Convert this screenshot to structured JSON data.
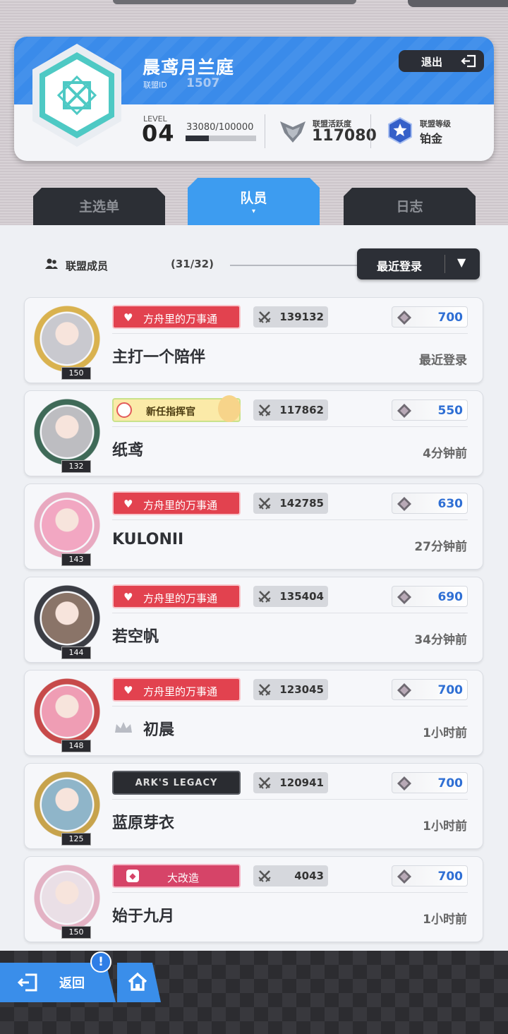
{
  "alliance": {
    "name": "晨鸢月兰庭",
    "id_label": "联盟ID",
    "id": "1507",
    "exit_label": "退出",
    "level_label": "LEVEL",
    "level": "04",
    "exp_text": "33080/100000",
    "exp_progress": 0.33,
    "activity_label": "联盟活跃度",
    "activity_value": "117080",
    "rank_label": "联盟等级",
    "rank_value": "铂金"
  },
  "tabs": [
    {
      "label": "主选单"
    },
    {
      "label": "队员",
      "active": true,
      "marker": "▾"
    },
    {
      "label": "日志"
    }
  ],
  "members_header": {
    "label": "联盟成员",
    "count": "(31/32)",
    "sort_label": "最近登录",
    "sort_caret": "▼"
  },
  "members": [
    {
      "name": "主打一个陪伴",
      "level": "150",
      "badge": "方舟里的万事通",
      "badge_type": "red",
      "power": "139132",
      "donation": "700",
      "last_login": "最近登录",
      "crown": false
    },
    {
      "name": "纸鸢",
      "level": "132",
      "badge": "新任指挥官",
      "badge_type": "newbie",
      "power": "117862",
      "donation": "550",
      "last_login": "4分钟前",
      "crown": false
    },
    {
      "name": "KULONII",
      "level": "143",
      "badge": "方舟里的万事通",
      "badge_type": "red",
      "power": "142785",
      "donation": "630",
      "last_login": "27分钟前",
      "crown": false
    },
    {
      "name": "若空帆",
      "level": "144",
      "badge": "方舟里的万事通",
      "badge_type": "red",
      "power": "135404",
      "donation": "690",
      "last_login": "34分钟前",
      "crown": false
    },
    {
      "name": "初晨",
      "level": "148",
      "badge": "方舟里的万事通",
      "badge_type": "red",
      "power": "123045",
      "donation": "700",
      "last_login": "1小时前",
      "crown": true
    },
    {
      "name": "蓝原芽衣",
      "level": "125",
      "badge": "ARK'S LEGACY",
      "badge_type": "legacy",
      "power": "120941",
      "donation": "700",
      "last_login": "1小时前",
      "crown": false
    },
    {
      "name": "始于九月",
      "level": "150",
      "badge": "大改造",
      "badge_type": "pink",
      "power": "4043",
      "donation": "700",
      "last_login": "1小时前",
      "crown": false
    }
  ],
  "bottom": {
    "back_label": "返回",
    "notice_mark": "!"
  },
  "colors": {
    "brand_blue": "#3a8bea",
    "badge_red": "#e2424f",
    "donation_blue": "#2f6fd4",
    "dark_panel": "#2c2f35"
  }
}
